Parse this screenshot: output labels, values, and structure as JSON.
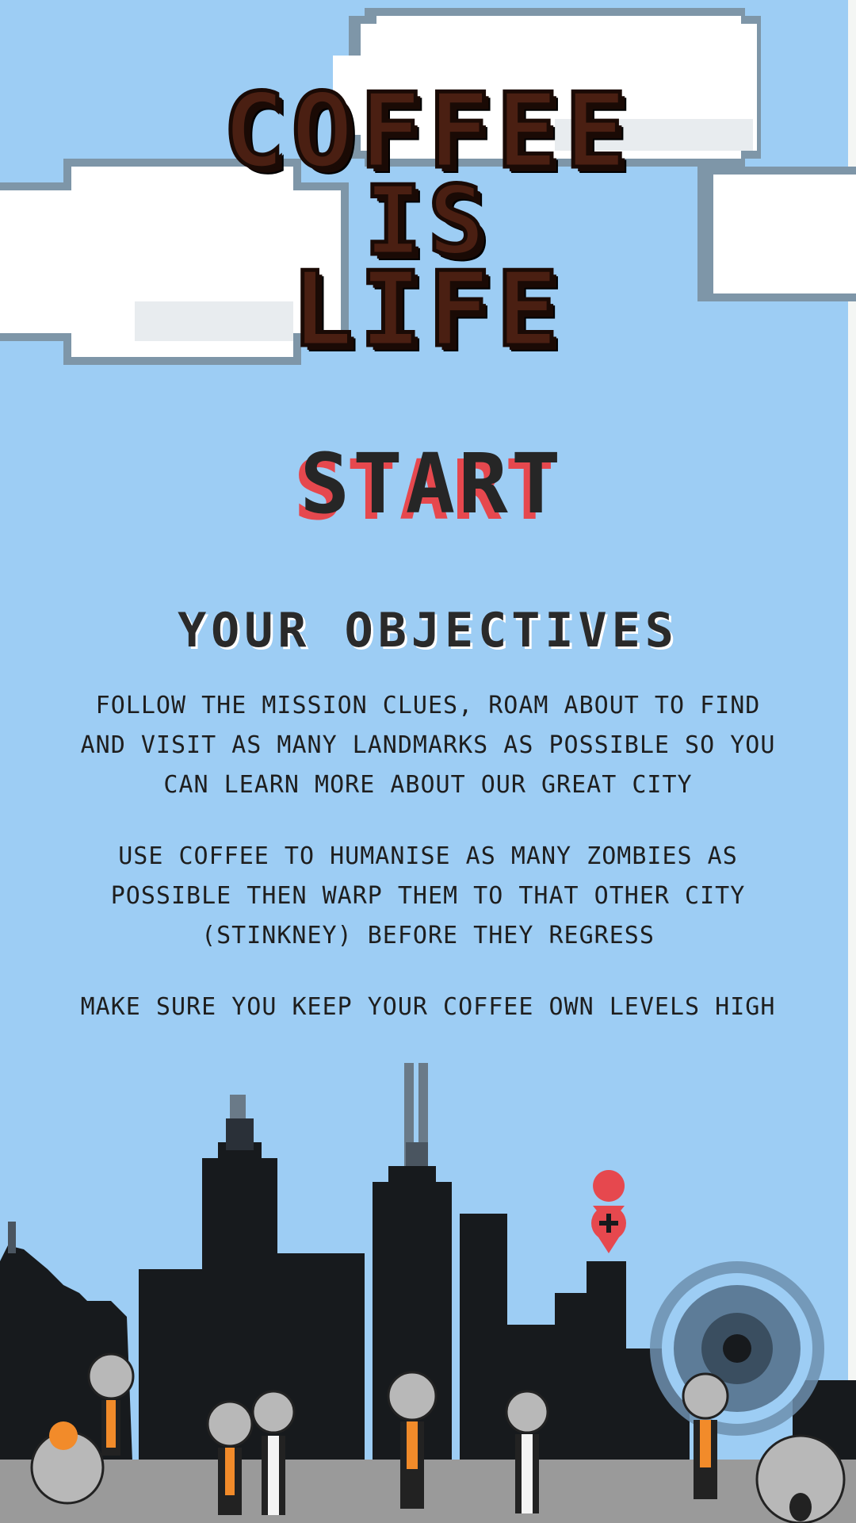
{
  "title": {
    "line1": "COFFEE",
    "line2": "IS",
    "line3": "LIFE"
  },
  "start_label": "START",
  "objectives": {
    "heading": "YOUR OBJECTIVES",
    "paragraphs": [
      "FOLLOW THE MISSION CLUES, ROAM ABOUT TO FIND AND  VISIT AS MANY LANDMARKS AS POSSIBLE SO YOU CAN LEARN MORE ABOUT OUR GREAT CITY",
      "USE COFFEE TO HUMANISE AS MANY ZOMBIES AS POSSIBLE THEN WARP THEM TO THAT OTHER CITY (STINKNEY) BEFORE THEY REGRESS",
      "MAKE SURE YOU KEEP YOUR COFFEE OWN LEVELS HIGH"
    ]
  },
  "colors": {
    "sky": "#9dcdf4",
    "title_brown": "#4a1f12",
    "start_red": "#e6484e",
    "skyline": "#171a1d",
    "ground": "#9a9a9a",
    "map_pin": "#e6484e"
  },
  "icons": [
    "map-pin-icon",
    "ferris-wheel-icon",
    "zombie-icon"
  ]
}
